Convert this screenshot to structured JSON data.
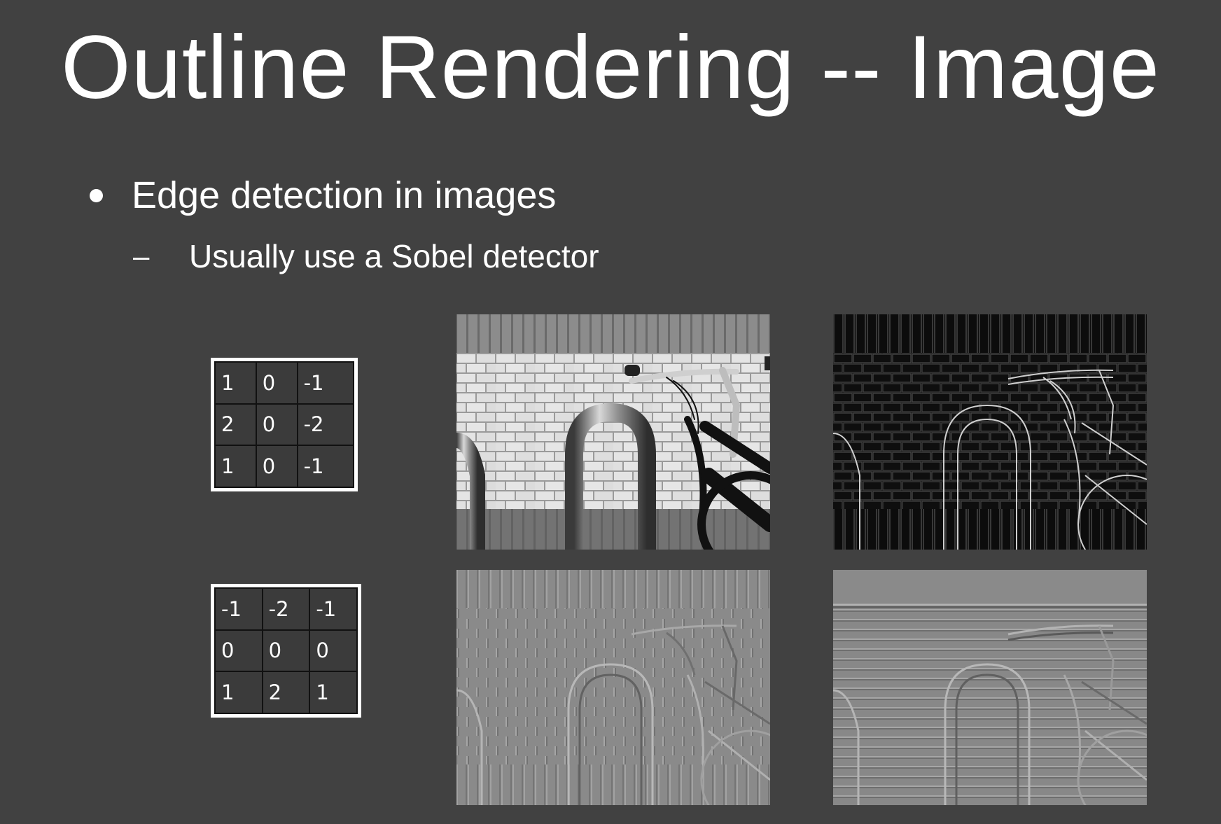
{
  "slide": {
    "title": "Outline Rendering -- Image",
    "bullet": "Edge detection in images",
    "sub_bullet": "Usually use a Sobel detector",
    "sub_marker": "–"
  },
  "kernels": [
    {
      "name": "sobel-x",
      "rows": [
        [
          "1",
          "0",
          "-1"
        ],
        [
          "2",
          "0",
          "-2"
        ],
        [
          "1",
          "0",
          "-1"
        ]
      ]
    },
    {
      "name": "sobel-y",
      "rows": [
        [
          "-1",
          "-2",
          "-1"
        ],
        [
          "0",
          "0",
          "0"
        ],
        [
          "1",
          "2",
          "1"
        ]
      ]
    }
  ],
  "images": [
    {
      "name": "original-photo",
      "style": "grayscale photo of brick wall with bike rack and bicycle"
    },
    {
      "name": "edge-magnitude",
      "style": "dark edge magnitude image"
    },
    {
      "name": "horizontal-gradient",
      "style": "gray embossed vertical edges"
    },
    {
      "name": "vertical-gradient",
      "style": "gray embossed horizontal edges"
    }
  ],
  "colors": {
    "background": "#414141",
    "text": "#ffffff"
  }
}
